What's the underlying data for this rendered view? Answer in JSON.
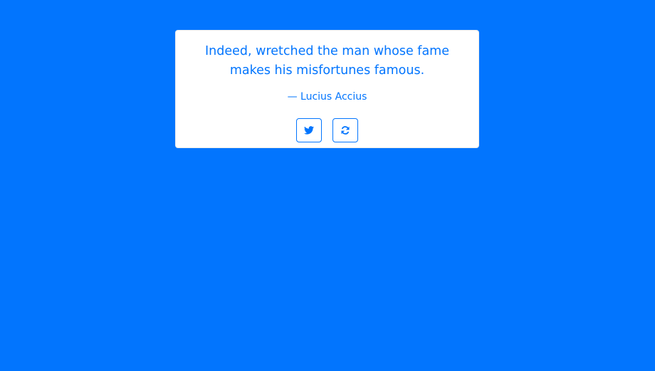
{
  "quote": {
    "text": "Indeed, wretched the man whose fame makes his misfortunes famous.",
    "author": "— Lucius Accius"
  },
  "actions": {
    "tweet_icon": "twitter-icon",
    "new_quote_icon": "refresh-icon"
  },
  "colors": {
    "background": "#0275fe",
    "card": "#ffffff",
    "accent": "#0275fe"
  }
}
